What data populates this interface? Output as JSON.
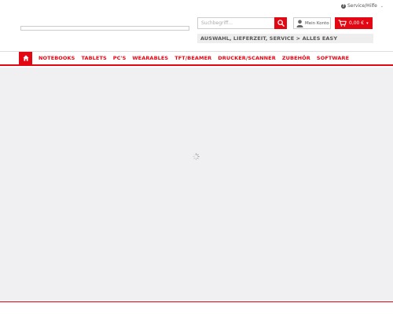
{
  "header": {
    "service_label": "Service/Hilfe",
    "search_placeholder": "Suchbegriff...",
    "account_label": "Mein Konto",
    "cart_total": "0,00 €",
    "cart_caret": "▾",
    "slogan": "AUSWAHL, LIEFERZEIT, SERVICE > ALLES EASY"
  },
  "nav": {
    "items": [
      {
        "label": "NOTEBOOKS"
      },
      {
        "label": "TABLETS"
      },
      {
        "label": "PC'S"
      },
      {
        "label": "WEARABLES"
      },
      {
        "label": "TFT/BEAMER"
      },
      {
        "label": "DRUCKER/SCANNER"
      },
      {
        "label": "ZUBEHÖR"
      },
      {
        "label": "SOFTWARE"
      }
    ]
  },
  "colors": {
    "brand": "#e30613",
    "main_bg": "#f0f0f3"
  },
  "icons": [
    "question-icon",
    "search-icon",
    "user-icon",
    "cart-icon",
    "home-icon",
    "loading-spinner-icon"
  ]
}
